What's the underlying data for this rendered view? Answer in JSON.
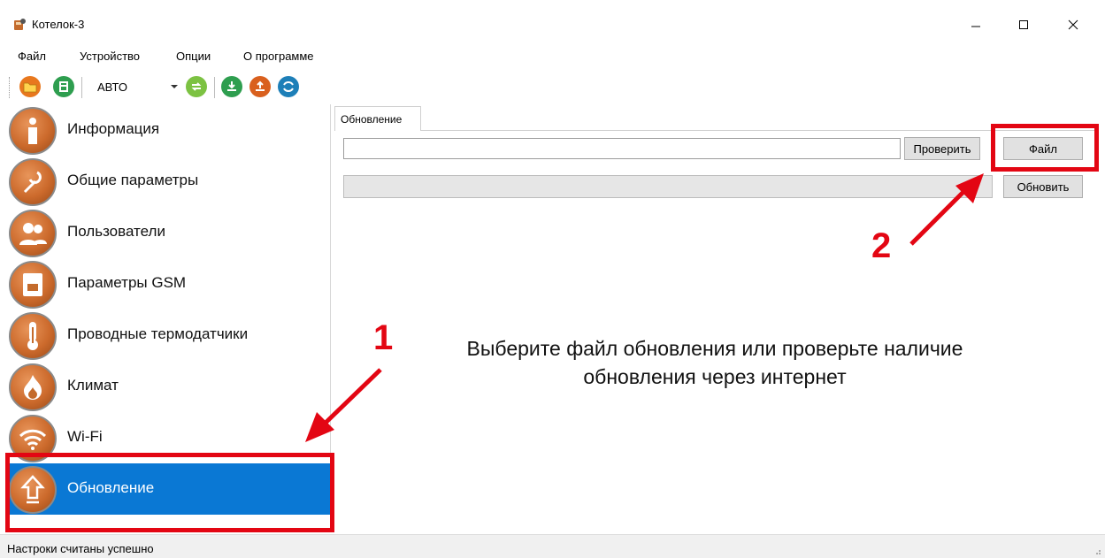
{
  "window": {
    "title": "Котелок-3",
    "icon": "boiler-app-icon"
  },
  "menu": [
    "Файл",
    "Устройство",
    "Опции",
    "О программе"
  ],
  "toolbar": {
    "mode_value": "АВТО",
    "buttons": [
      "open-folder-icon",
      "save-icon",
      "connect-arrows-icon",
      "download-icon",
      "upload-icon",
      "sync-icon"
    ]
  },
  "sidebar": {
    "items": [
      {
        "label": "Информация",
        "icon": "info-icon"
      },
      {
        "label": "Общие параметры",
        "icon": "wrench-icon"
      },
      {
        "label": "Пользователи",
        "icon": "users-icon"
      },
      {
        "label": "Параметры GSM",
        "icon": "sim-card-icon"
      },
      {
        "label": "Проводные термодатчики",
        "icon": "thermometer-icon"
      },
      {
        "label": "Климат",
        "icon": "flame-icon"
      },
      {
        "label": "Wi-Fi",
        "icon": "wifi-icon"
      },
      {
        "label": "Обновление",
        "icon": "upload-arrow-icon",
        "active": true
      }
    ]
  },
  "update_tab": {
    "tab_label": "Обновление",
    "check_button": "Проверить",
    "file_button": "Файл",
    "update_button": "Обновить"
  },
  "annotations": {
    "step1": "1",
    "step2": "2",
    "instruction_line1": "Выберите файл обновления или проверьте наличие",
    "instruction_line2": "обновления через интернет",
    "highlight_color": "#e30613"
  },
  "status": {
    "text": "Настроки считаны успешно"
  },
  "colors": {
    "selection": "#0a78d4",
    "icon_orange": "#cc6a2c"
  }
}
